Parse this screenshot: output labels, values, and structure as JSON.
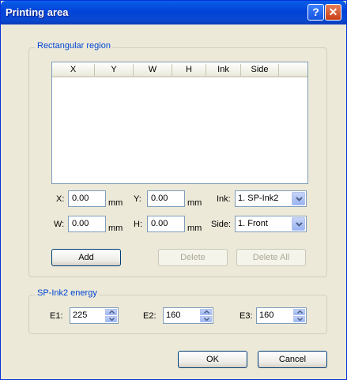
{
  "window": {
    "title": "Printing area"
  },
  "titlebar_buttons": {
    "help": "?",
    "close": "✕"
  },
  "rect_group": {
    "label": "Rectangular region",
    "columns": [
      "X",
      "Y",
      "W",
      "H",
      "Ink",
      "Side"
    ],
    "fields": {
      "x_label": "X:",
      "x_value": "0.00",
      "x_unit": "mm",
      "y_label": "Y:",
      "y_value": "0.00",
      "y_unit": "mm",
      "w_label": "W:",
      "w_value": "0.00",
      "w_unit": "mm",
      "h_label": "H:",
      "h_value": "0.00",
      "h_unit": "mm",
      "ink_label": "Ink:",
      "ink_value": "1. SP-Ink2",
      "side_label": "Side:",
      "side_value": "1. Front"
    },
    "buttons": {
      "add": "Add",
      "delete": "Delete",
      "delete_all": "Delete All"
    }
  },
  "energy_group": {
    "label": "SP-Ink2 energy",
    "e1_label": "E1:",
    "e1_value": "225",
    "e2_label": "E2:",
    "e2_value": "160",
    "e3_label": "E3:",
    "e3_value": "160"
  },
  "dialog_buttons": {
    "ok": "OK",
    "cancel": "Cancel"
  },
  "colors": {
    "titlebar": "#0054e3",
    "group_label": "#0046d5",
    "dialog_bg": "#ece9d8"
  }
}
